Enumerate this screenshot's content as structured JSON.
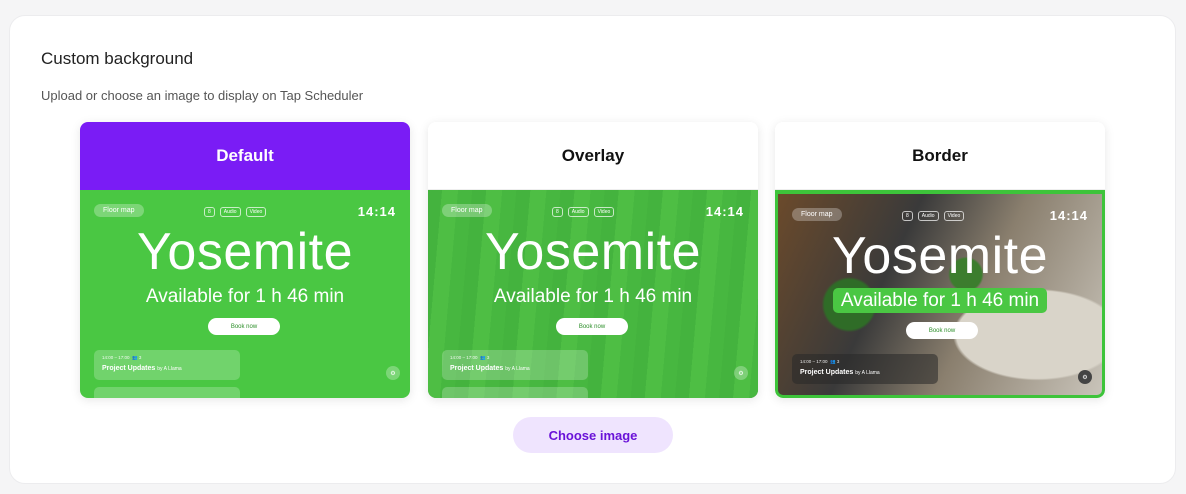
{
  "section": {
    "title": "Custom background",
    "subtitle": "Upload or choose an image to display on Tap Scheduler"
  },
  "options": [
    {
      "label": "Default",
      "selected": true
    },
    {
      "label": "Overlay",
      "selected": false
    },
    {
      "label": "Border",
      "selected": false
    }
  ],
  "preview": {
    "floor_map": "Floor map",
    "chips": [
      "8",
      "Audio",
      "Video"
    ],
    "clock": "14:14",
    "room": "Yosemite",
    "availability": "Available for 1 h 46 min",
    "book_button": "Book now",
    "meeting_time": "14:00 – 17:00",
    "meeting_attendees": "3",
    "meeting_title": "Project Updates",
    "meeting_by": "by A Llama",
    "settings_icon": "gear-icon"
  },
  "actions": {
    "choose_image": "Choose image"
  },
  "colors": {
    "accent": "#7a1cf5",
    "preview_green": "#4ac743",
    "button_bg": "#efe4fe",
    "button_text": "#6a12d8"
  }
}
